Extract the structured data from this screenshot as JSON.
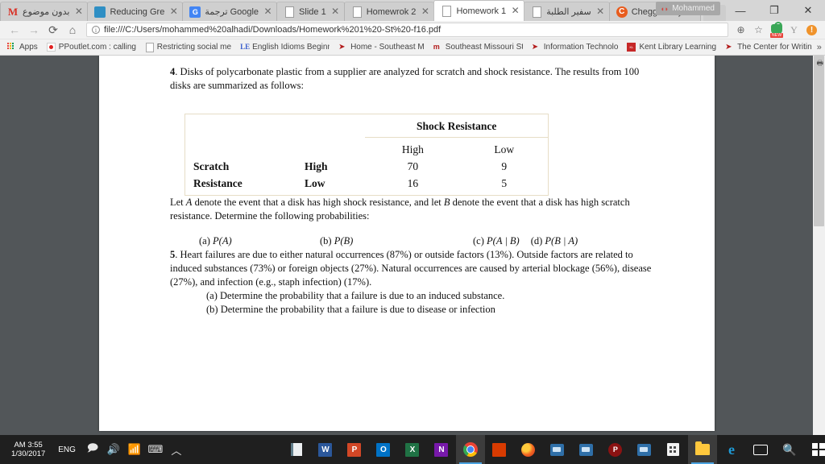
{
  "browser": {
    "tabs": [
      {
        "label": "بدون موضوع",
        "favicon": "gmail-icon",
        "active": false
      },
      {
        "label": "Reducing Gre",
        "favicon": "recycle-icon",
        "active": false
      },
      {
        "label": "ترجمة Google",
        "favicon": "google-translate-icon",
        "active": false
      },
      {
        "label": "Slide 1",
        "favicon": "page-icon",
        "active": false
      },
      {
        "label": "Homewrok 2",
        "favicon": "page-icon",
        "active": false
      },
      {
        "label": "Homework 1",
        "favicon": "page-icon",
        "active": true
      },
      {
        "label": "سفير الطلبة",
        "favicon": "page-icon",
        "active": false
      },
      {
        "label": "Chegg Study",
        "favicon": "chegg-icon",
        "active": false
      }
    ],
    "close_glyph": "✕",
    "profile": {
      "name": "Mohammed",
      "icon": "profile-icon"
    },
    "window_controls": {
      "minimize": "―",
      "maximize": "❐",
      "close": "✕"
    },
    "toolbar": {
      "back": "←",
      "forward": "→",
      "reload": "⟳",
      "home": "⌂",
      "url": "file:///C:/Users/mohammed%20alhadi/Downloads/Homework%201%20-St%20-f16.pdf",
      "url_info_glyph": "i",
      "zoom_icon": "⊕",
      "star_icon": "☆",
      "ext_new_badge": "NEW",
      "ext_y_label": "Y",
      "ext_alert_label": "!"
    },
    "bookmarks": {
      "items": [
        {
          "label": "Apps",
          "icon": "apps-grid-icon"
        },
        {
          "label": "PPoutlet.com : calling",
          "icon": "red-dot-icon"
        },
        {
          "label": "Restricting social me",
          "icon": "page-icon"
        },
        {
          "label": "English Idioms Beginn",
          "icon": "le-icon"
        },
        {
          "label": "Home - Southeast M",
          "icon": "redhawk-icon"
        },
        {
          "label": "Southeast Missouri St",
          "icon": "semo-icon"
        },
        {
          "label": "Information Technolo",
          "icon": "redhawk-icon"
        },
        {
          "label": "Kent Library Learning",
          "icon": "kent-library-icon"
        },
        {
          "label": "The Center for Writin",
          "icon": "redhawk-icon"
        }
      ],
      "overflow_glyph": "»"
    },
    "viewer": {
      "print_icon": "print-icon"
    }
  },
  "document": {
    "q4": {
      "number": "4",
      "text": ". Disks of polycarbonate plastic from a supplier are analyzed for scratch and shock resistance. The results from 100 disks are summarized as follows:",
      "table": {
        "title": "Shock Resistance",
        "col_headers": [
          "High",
          "Low"
        ],
        "row_group_label_line1": "Scratch",
        "row_group_label_line2": "Resistance",
        "rows": [
          {
            "label": "High",
            "values": [
              "70",
              "9"
            ]
          },
          {
            "label": "Low",
            "values": [
              "16",
              "5"
            ]
          }
        ]
      },
      "let_text_1": "Let ",
      "let_var_a": "A",
      "let_text_2": " denote the event that a disk has high shock resistance, and let ",
      "let_var_b": "B",
      "let_text_3": " denote the event that a disk has high scratch resistance. Determine the following probabilities:",
      "parts": [
        {
          "tag": "(a)",
          "expr_pre": "P(",
          "expr_var": "A",
          "expr_post": ")"
        },
        {
          "tag": "(b)",
          "expr_pre": "P(",
          "expr_var": "B",
          "expr_post": ")"
        },
        {
          "tag": "(c)",
          "expr_pre": "P(",
          "expr_var": "A | B",
          "expr_post": ")"
        },
        {
          "tag": "(d)",
          "expr_pre": "P(",
          "expr_var": "B | A",
          "expr_post": ")"
        }
      ]
    },
    "q5": {
      "number": "5",
      "text": ". Heart failures are due to either natural occurrences (87%) or outside factors (13%). Outside factors are related to induced substances (73%) or foreign objects (27%). Natural occurrences are caused by arterial blockage (56%), disease (27%), and infection (e.g., staph infection) (17%).",
      "sub_a": "(a) Determine the probability that a failure is due to an induced substance.",
      "sub_b": "(b) Determine the probability that a failure is due to disease or infection"
    }
  },
  "taskbar": {
    "clock": {
      "time": "AM 3:55",
      "date": "1/30/2017"
    },
    "language": "ENG",
    "tray_icons": [
      "action-center-icon",
      "volume-icon",
      "wifi-icon",
      "keyboard-icon",
      "show-hidden-icons-chevron"
    ],
    "apps": [
      {
        "name": "text-editor",
        "icon": "editor-icon",
        "active": false
      },
      {
        "name": "word",
        "icon": "word-icon",
        "label": "W",
        "active": false
      },
      {
        "name": "powerpoint",
        "icon": "powerpoint-icon",
        "label": "P",
        "active": false
      },
      {
        "name": "outlook",
        "icon": "outlook-icon",
        "label": "O",
        "active": false
      },
      {
        "name": "excel",
        "icon": "excel-icon",
        "label": "X",
        "active": false
      },
      {
        "name": "onenote",
        "icon": "onenote-icon",
        "label": "N",
        "active": false
      },
      {
        "name": "chrome",
        "icon": "chrome-icon",
        "active": true
      },
      {
        "name": "office",
        "icon": "office-icon",
        "active": false
      },
      {
        "name": "firefox",
        "icon": "firefox-icon",
        "active": false
      },
      {
        "name": "teamviewer",
        "icon": "teamviewer-icon",
        "active": false
      },
      {
        "name": "teamviewer2",
        "icon": "teamviewer-icon",
        "active": false
      },
      {
        "name": "pdf-reader",
        "icon": "pdf-icon",
        "label": "P",
        "active": false
      },
      {
        "name": "remote-desktop",
        "icon": "remote-desktop-icon",
        "active": false
      },
      {
        "name": "store",
        "icon": "store-icon",
        "active": false
      },
      {
        "name": "file-explorer",
        "icon": "folder-icon",
        "active": true
      },
      {
        "name": "edge",
        "icon": "edge-icon",
        "label": "e",
        "active": false
      },
      {
        "name": "task-view",
        "icon": "task-view-icon",
        "active": false
      },
      {
        "name": "search",
        "icon": "search-icon",
        "active": false
      },
      {
        "name": "start",
        "icon": "windows-logo-icon",
        "active": false
      }
    ]
  }
}
